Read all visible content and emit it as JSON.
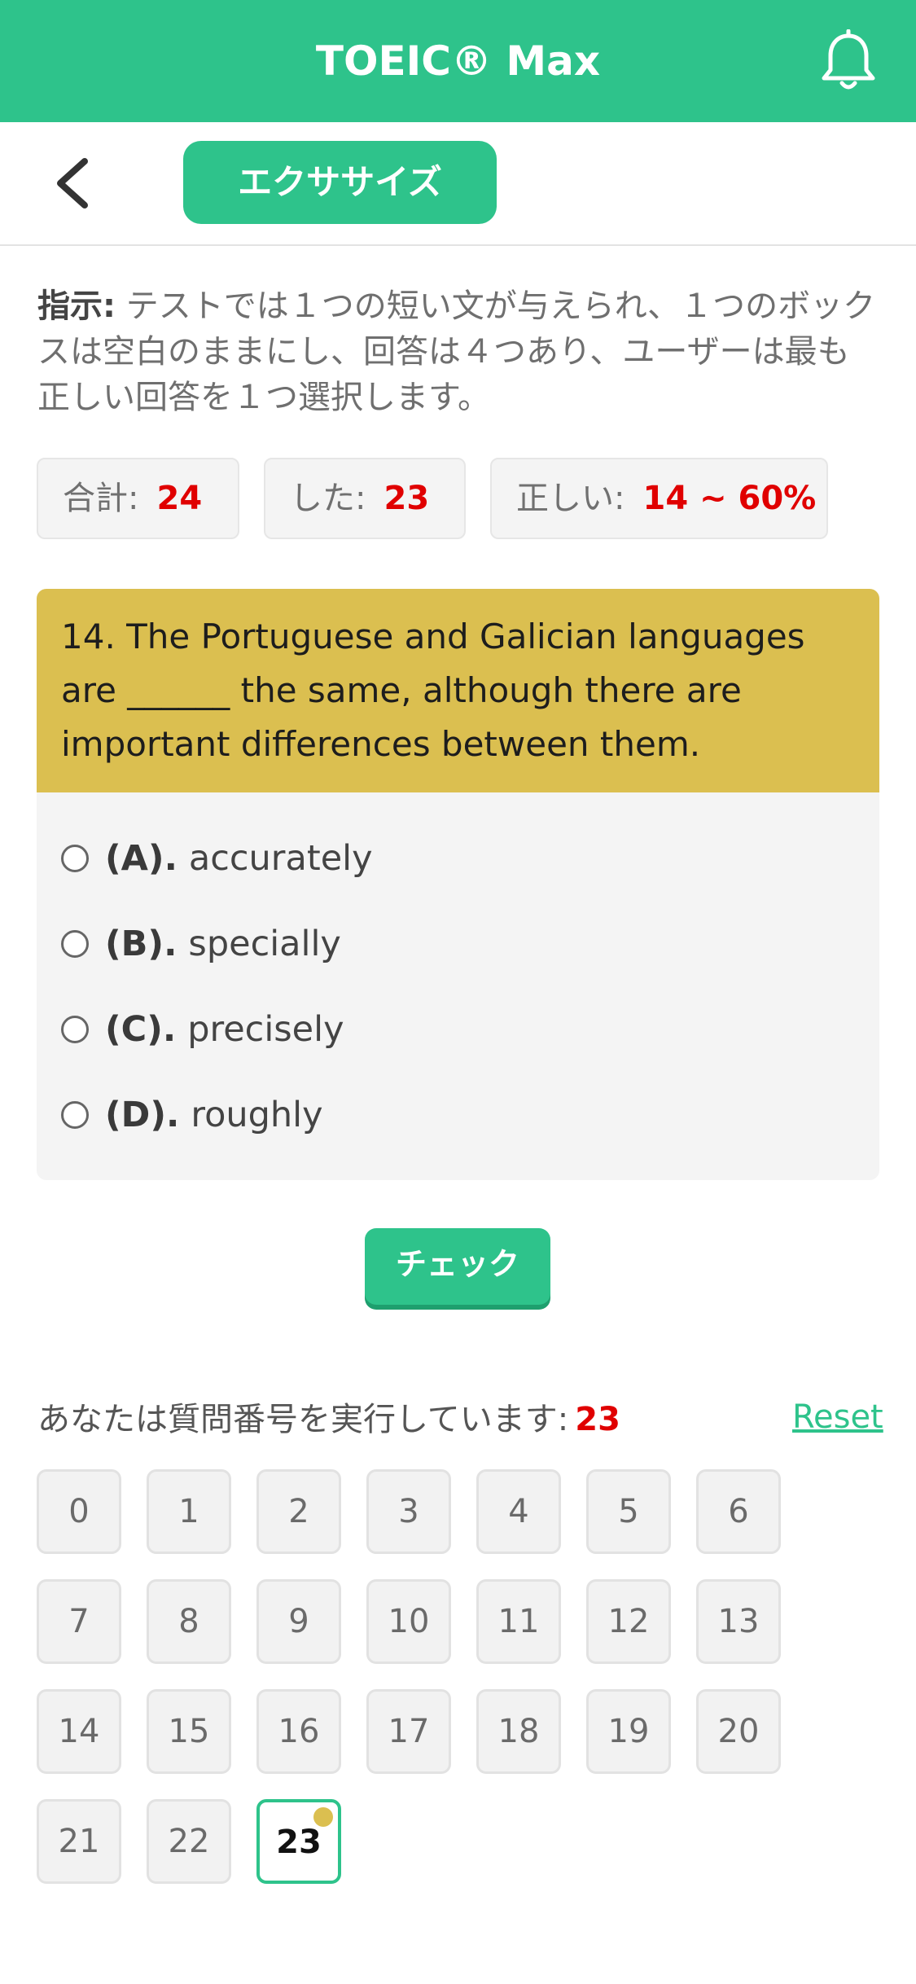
{
  "app": {
    "title": "TOEIC® Max",
    "exercise_label": "エクササイズ"
  },
  "instructions": {
    "label": "指示:",
    "text": " テストでは１つの短い文が与えられ、１つのボックスは空白のままにし、回答は４つあり、ユーザーは最も正しい回答を１つ選択します。"
  },
  "stats": {
    "total_label": "合計:",
    "total_value": "24",
    "done_label": "した:",
    "done_value": "23",
    "correct_label": "正しい:",
    "correct_value": "14 ~ 60%"
  },
  "question": {
    "text": "14. The Portuguese and Galician languages are ______ the same, although there are important differences between them.",
    "options": [
      {
        "letter": "(A).",
        "text": "accurately"
      },
      {
        "letter": "(B).",
        "text": "specially"
      },
      {
        "letter": "(C).",
        "text": "precisely"
      },
      {
        "letter": "(D).",
        "text": "roughly"
      }
    ]
  },
  "check_label": "チェック",
  "progress": {
    "label": "あなたは質問番号を実行しています:",
    "current": "23",
    "reset_label": "Reset"
  },
  "question_numbers": [
    "0",
    "1",
    "2",
    "3",
    "4",
    "5",
    "6",
    "7",
    "8",
    "9",
    "10",
    "11",
    "12",
    "13",
    "14",
    "15",
    "16",
    "17",
    "18",
    "19",
    "20",
    "21",
    "22",
    "23"
  ],
  "current_index": 23,
  "colors": {
    "accent": "#2ec38b",
    "question_bg": "#dbbf50",
    "highlight": "#e00000"
  }
}
